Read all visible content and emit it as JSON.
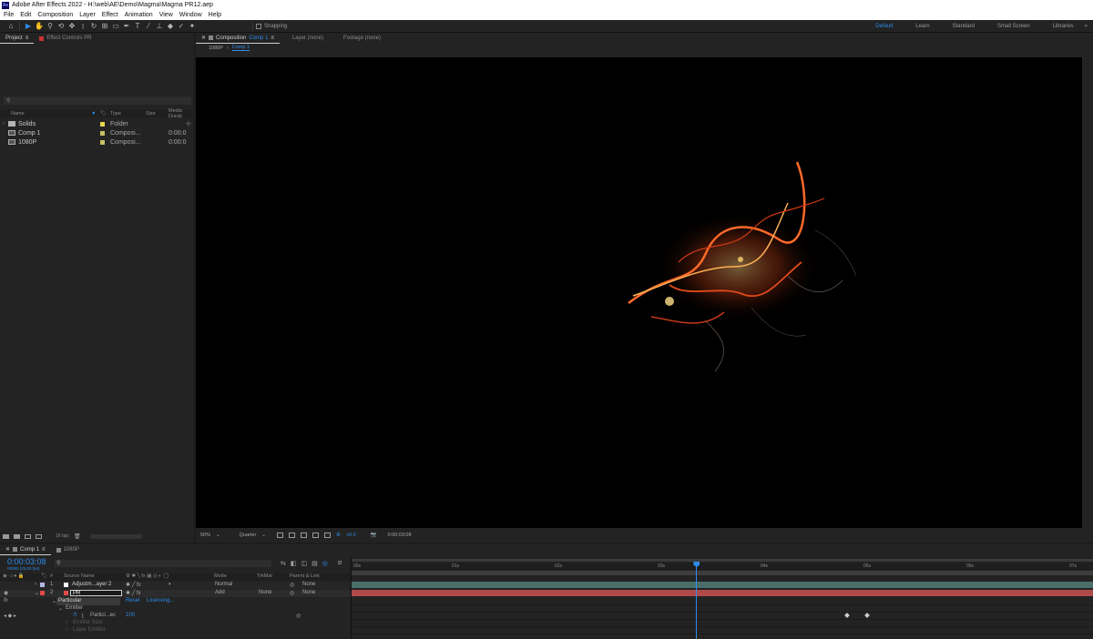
{
  "app": {
    "title": "Adobe After Effects 2022 - H:\\web\\AE\\Demo\\Magma\\Magma PR12.aep",
    "logo": "Ae"
  },
  "menu": [
    "File",
    "Edit",
    "Composition",
    "Layer",
    "Effect",
    "Animation",
    "View",
    "Window",
    "Help"
  ],
  "toolbar": {
    "snapping_label": "Snapping"
  },
  "workspaces": {
    "items": [
      "Default",
      "Learn",
      "Standard",
      "Small Screen",
      "Libraries"
    ],
    "active": "Default",
    "overflow": "»"
  },
  "project_panel": {
    "tab_project": "Project",
    "tab_effect_controls": "Effect Controls PR",
    "search_placeholder": "",
    "columns": [
      "Name",
      "Type",
      "Size",
      "Media Durati"
    ],
    "items": [
      {
        "name": "Solids",
        "type": "Folder",
        "size": "",
        "duration": "",
        "label_color": "#e5d94a",
        "icon": "folder-icon"
      },
      {
        "name": "Comp 1",
        "type": "Composi...",
        "size": "",
        "duration": "0:00:0",
        "label_color": "#c9c064",
        "icon": "composition-icon"
      },
      {
        "name": "1080P",
        "type": "Composi...",
        "size": "",
        "duration": "0:00:0",
        "label_color": "#c9c064",
        "icon": "composition-icon"
      }
    ],
    "footer_bpc": "16 bpc"
  },
  "comp_panel": {
    "tab_composition": "Composition",
    "tab_comp_name": "Comp 1",
    "tab_layer": "Layer (none)",
    "tab_footage": "Footage (none)",
    "breadcrumbs": [
      "1080P",
      "Comp 1"
    ],
    "zoom": "50%",
    "resolution": "Quarter",
    "exposure": "+0.0",
    "timecode": "0:00:03:08"
  },
  "timeline": {
    "tabs": [
      "Comp 1",
      "1080P"
    ],
    "current_time": "0:00:03:08",
    "fps_info": "00080 (25.00 fps)",
    "columns": {
      "source_name": "Source Name",
      "mode": "Mode",
      "trkmat": "TrkMat",
      "parent": "Parent & Link"
    },
    "layers": [
      {
        "num": "1",
        "name": "Adjustm...ayer 2",
        "mode": "Normal",
        "trkmat": "",
        "parent": "None",
        "label_color": "#b5b5e6"
      },
      {
        "num": "2",
        "name": "PR",
        "mode": "Add",
        "trkmat": "None",
        "parent": "None",
        "label_color": "#e04a4a"
      }
    ],
    "effect": {
      "name": "Particular",
      "reset": "Reset",
      "licensing": "Licensing..."
    },
    "sub_items": [
      "Emitter",
      "Particl...ec",
      "Emitter Size",
      "Layer Emitter"
    ],
    "particl_value": "100",
    "ruler": [
      "00s",
      "01s",
      "02s",
      "03s",
      "04s",
      "05s",
      "06s",
      "07s"
    ],
    "playhead_fraction": 0.4643
  },
  "colors": {
    "accent": "#2d8ceb",
    "layer1_bar": "#4a6e6a",
    "layer2_bar": "#b04a4a"
  }
}
